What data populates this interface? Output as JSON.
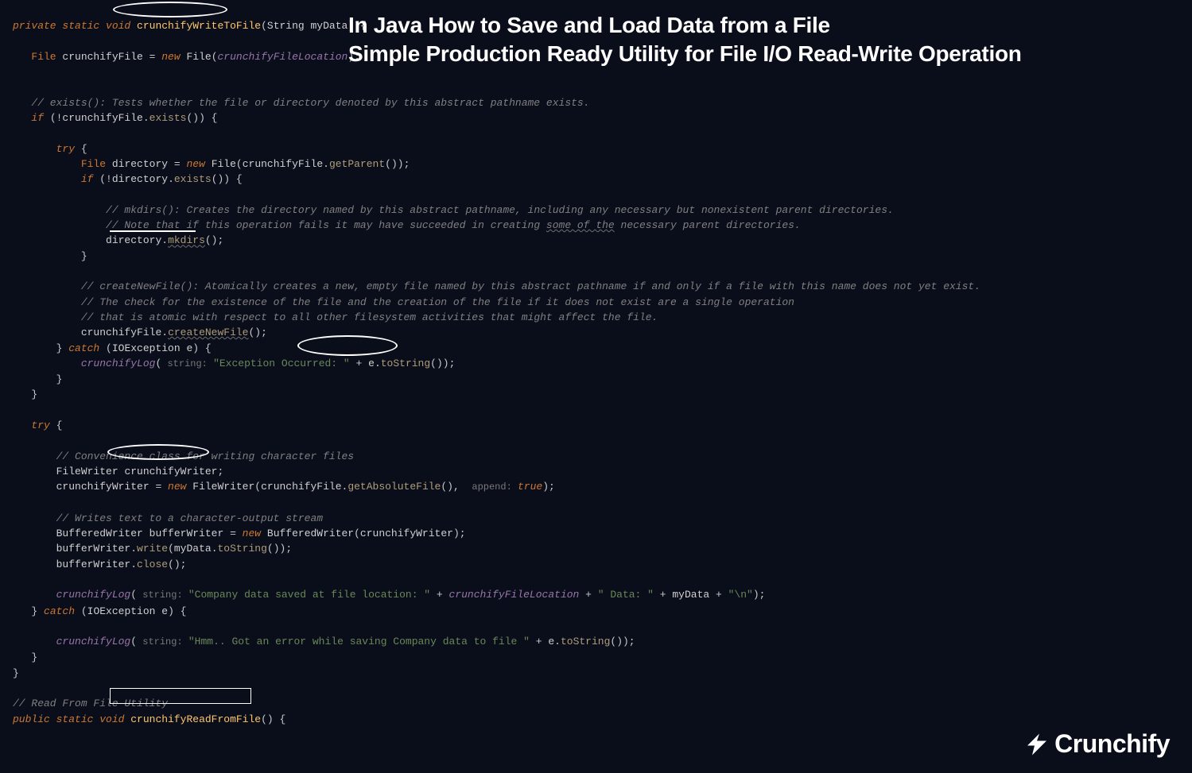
{
  "title": {
    "line1": "In Java How to Save and Load Data from a File",
    "line2": "Simple Production Ready Utility for File I/O Read-Write Operation"
  },
  "logo_text": "Crunchify",
  "code": {
    "l1": {
      "mods": "private static void",
      "fn": "crunchifyWriteToFile",
      "paren_open": "(",
      "ptype": "String ",
      "pname": "myData",
      "rest": ") {"
    },
    "l3": {
      "type": "File ",
      "var": "crunchifyFile",
      "eq": " = ",
      "new": "new ",
      "ctor": "File",
      "op": "(",
      "arg": "crunchifyFileLocation",
      "cl": ");"
    },
    "l6": "// exists(): Tests whether the file or directory denoted by this abstract pathname exists.",
    "l7": {
      "if": "if ",
      "op": "(!",
      "var": "crunchifyFile",
      "dot": ".",
      "call": "exists",
      "rest": "()) {"
    },
    "l9": {
      "try": "try ",
      "brace": "{"
    },
    "l10": {
      "type": "File ",
      "var": "directory",
      "eq": " = ",
      "new": "new ",
      "ctor": "File",
      "op": "(",
      "obj": "crunchifyFile",
      "dot": ".",
      "call": "getParent",
      "rest": "());"
    },
    "l11": {
      "if": "if ",
      "op": "(!",
      "var": "directory",
      "dot": ".",
      "call": "exists",
      "rest": "()) {"
    },
    "l13": "// mkdirs(): Creates the directory named by this abstract pathname, including any necessary but nonexistent parent directories.",
    "l14a": "// Note that if this operation fails it may have succeeded in creating ",
    "l14b": "some of the",
    "l14c": " necessary parent directories.",
    "l15": {
      "var": "directory",
      "dot": ".",
      "call": "mkdirs",
      "rest": "();"
    },
    "l16": "}",
    "l18": "// createNewFile(): Atomically creates a new, empty file named by this abstract pathname if and only if a file with this name does not yet exist.",
    "l19": "// The check for the existence of the file and the creation of the file if it does not exist are a single operation",
    "l20": "// that is atomic with respect to all other filesystem activities that might affect the file.",
    "l21": {
      "var": "crunchifyFile",
      "dot": ".",
      "call": "createNewFile",
      "rest": "();"
    },
    "l22": {
      "close": "} ",
      "catch": "catch ",
      "op": "(",
      "type": "IOException ",
      "e": "e",
      "rest": ") {"
    },
    "l23": {
      "fn": "crunchifyLog",
      "op": "(",
      "hint": " string: ",
      "str": "\"Exception Occurred: \"",
      "plus": " + ",
      "e": "e",
      "dot": ".",
      "call": "toString",
      "rest": "());"
    },
    "l24": "}",
    "l25": "}",
    "l27": {
      "try": "try ",
      "brace": "{"
    },
    "l29": "// Convenience class for writing character files",
    "l30": {
      "type": "FileWriter ",
      "var": "crunchifyWriter",
      "semi": ";"
    },
    "l31": {
      "var": "crunchifyWriter",
      "eq": " = ",
      "new": "new ",
      "ctor": "FileWriter",
      "op": "(",
      "obj": "crunchifyFile",
      "dot": ".",
      "call": "getAbsoluteFile",
      "mid": "(),  ",
      "hint": "append: ",
      "val": "true",
      "rest": ");"
    },
    "l33": "// Writes text to a character-output stream",
    "l34": {
      "type": "BufferedWriter ",
      "var": "bufferWriter",
      "eq": " = ",
      "new": "new ",
      "ctor": "BufferedWriter",
      "op": "(",
      "arg": "crunchifyWriter",
      "rest": ");"
    },
    "l35": {
      "var": "bufferWriter",
      "dot": ".",
      "call": "write",
      "op": "(",
      "arg": "myData",
      "dot2": ".",
      "call2": "toString",
      "rest": "());"
    },
    "l36": {
      "var": "bufferWriter",
      "dot": ".",
      "call": "close",
      "rest": "();"
    },
    "l38": {
      "fn": "crunchifyLog",
      "op": "(",
      "hint": " string: ",
      "str1": "\"Company data saved at file location: \"",
      "p1": " + ",
      "f1": "crunchifyFileLocation",
      "p2": " + ",
      "str2": "\" Data: \"",
      "p3": " + ",
      "v": "myData",
      "p4": " + ",
      "str3": "\"\\n\"",
      "rest": ");"
    },
    "l39": {
      "close": "} ",
      "catch": "catch ",
      "op": "(",
      "type": "IOException ",
      "e": "e",
      "rest": ") {"
    },
    "l41": {
      "fn": "crunchifyLog",
      "op": "(",
      "hint": " string: ",
      "str": "\"Hmm.. Got an error while saving Company data to file \"",
      "plus": " + ",
      "e": "e",
      "dot": ".",
      "call": "toString",
      "rest": "());"
    },
    "l42": "}",
    "l43": "}",
    "l45": "// Read From File Utility",
    "l46": {
      "mods": "public static void",
      "fn": "crunchifyReadFromFile",
      "rest": "() {"
    }
  }
}
